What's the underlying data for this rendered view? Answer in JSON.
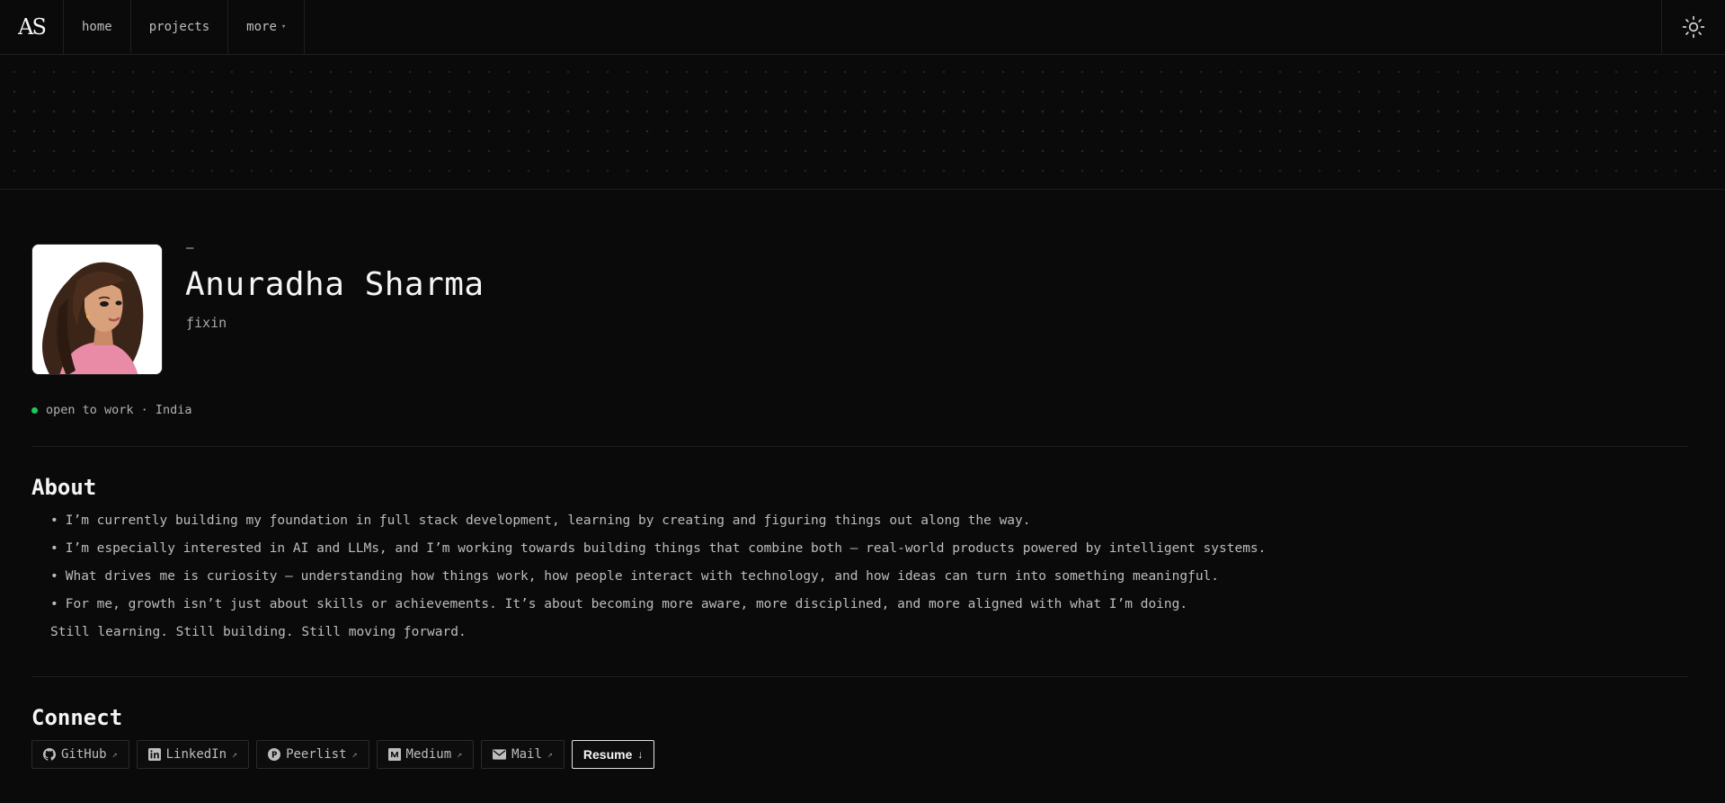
{
  "nav": {
    "logo": "AS",
    "items": [
      {
        "label": "home"
      },
      {
        "label": "projects"
      },
      {
        "label": "more",
        "caret": "▾"
      }
    ],
    "theme_icon": "sun-icon"
  },
  "profile": {
    "dash": "–",
    "name": "Anuradha Sharma",
    "handle": "ƒixin",
    "status": "open to work · India",
    "status_color": "#22c55e"
  },
  "about": {
    "title": "About",
    "bullet": "•",
    "items": [
      "I’m currently building my ƒoundation in ƒull stack development, learning by creating and ƒiguring things out along the way.",
      "I’m especially interested in AI and LLMs, and I’m working towards building things that combine both — real-world products powered by intelligent systems.",
      "What drives me is curiosity — understanding how things work, how people interact with technology, and how ideas can turn into something meaningƒul.",
      "For me, growth isn’t just about skills or achievements. It’s about becoming more aware, more disciplined, and more aligned with what I’m doing."
    ],
    "closing": "Still learning. Still building. Still moving ƒorward."
  },
  "connect": {
    "title": "Connect",
    "links": [
      {
        "label": "GitHub",
        "icon": "github-icon",
        "arrow": "↗"
      },
      {
        "label": "LinkedIn",
        "icon": "linkedin-icon",
        "arrow": "↗"
      },
      {
        "label": "Peerlist",
        "icon": "peerlist-icon",
        "arrow": "↗"
      },
      {
        "label": "Medium",
        "icon": "medium-icon",
        "arrow": "↗"
      },
      {
        "label": "Mail",
        "icon": "mail-icon",
        "arrow": "↗"
      },
      {
        "label": "Resume",
        "icon": "download-icon",
        "arrow": "↓"
      }
    ]
  },
  "colors": {
    "background": "#0a0a0a",
    "text": "#d4d4d4",
    "border": "#1f1f1f",
    "accent_status": "#22c55e"
  }
}
